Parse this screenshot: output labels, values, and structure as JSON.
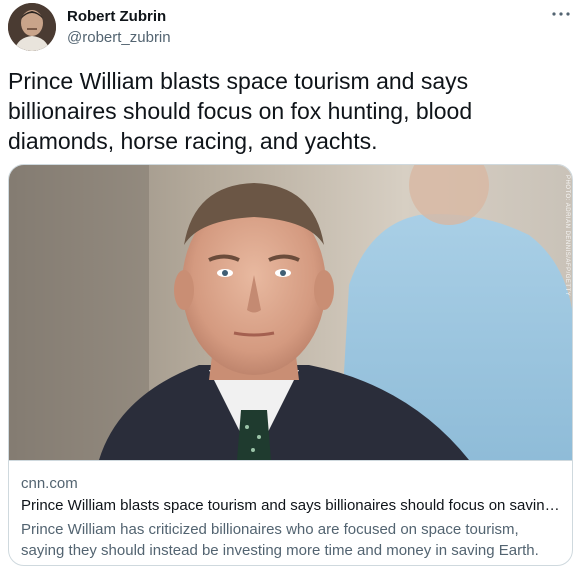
{
  "author": {
    "display_name": "Robert Zubrin",
    "handle": "@robert_zubrin"
  },
  "tweet": {
    "text": "Prince William blasts space tourism and says billionaires should focus on fox hunting, blood diamonds, horse racing, and yachts."
  },
  "card": {
    "domain": "cnn.com",
    "title": "Prince William blasts space tourism and says billionaires should focus on savin…",
    "description": "Prince William has criticized billionaires who are focused on space tourism, saying they should instead be investing more time and money in saving Earth.",
    "photo_credit": "PHOTO: ADRIAN DENNIS/AFP/GETTY"
  },
  "icons": {
    "more": "more-horizontal-icon"
  },
  "colors": {
    "text_primary": "#0f1419",
    "text_secondary": "#536471",
    "border": "#cfd9de",
    "background": "#ffffff"
  }
}
